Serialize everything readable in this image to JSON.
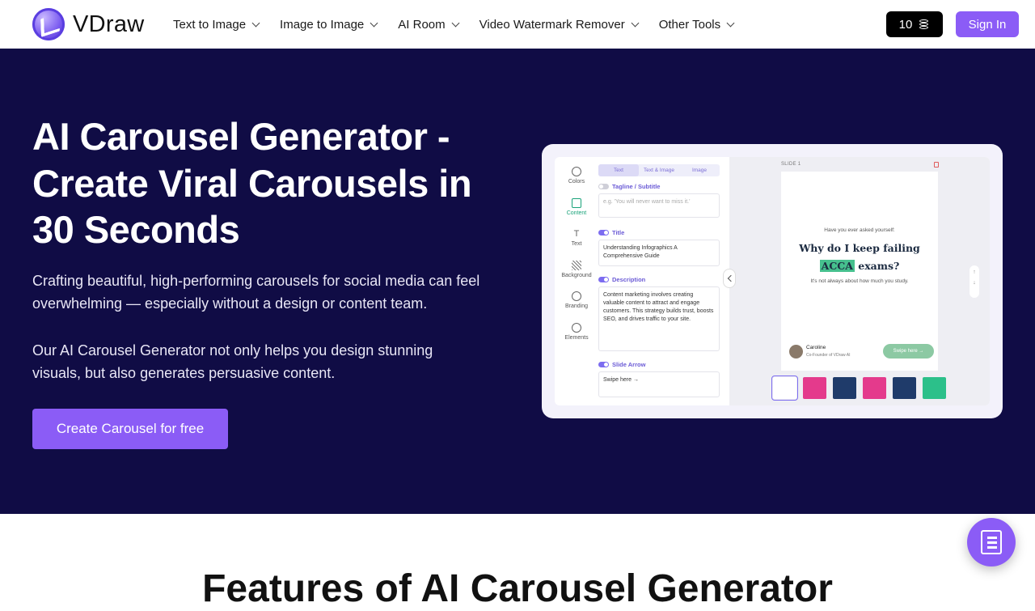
{
  "brand": {
    "name": "VDraw"
  },
  "nav": {
    "items": [
      {
        "label": "Text to Image"
      },
      {
        "label": "Image to Image"
      },
      {
        "label": "AI Room"
      },
      {
        "label": "Video Watermark Remover"
      },
      {
        "label": "Other Tools"
      }
    ],
    "credits": "10",
    "sign_in": "Sign In"
  },
  "hero": {
    "title": "AI Carousel Generator - Create Viral Carousels in 30 Seconds",
    "p1": "Crafting beautiful, high-performing carousels for social media can feel overwhelming — especially without a design or content team.",
    "p2": "Our AI Carousel Generator not only helps you design stunning visuals, but also generates persuasive content.",
    "cta": "Create Carousel for free"
  },
  "preview": {
    "sidebar": [
      {
        "label": "Colors"
      },
      {
        "label": "Content"
      },
      {
        "label": "Text"
      },
      {
        "label": "Background"
      },
      {
        "label": "Branding"
      },
      {
        "label": "Elements"
      }
    ],
    "tabs": [
      "Text",
      "Text & Image",
      "Image"
    ],
    "tagline_label": "Tagline / Subtitle",
    "tagline_placeholder": "e.g. 'You will never want to miss it.'",
    "title_label": "Title",
    "title_value": "Understanding Infographics A Comprehensive Guide",
    "description_label": "Description",
    "description_value": "Content marketing involves creating valuable content to attract and engage customers. This strategy builds trust, boosts SEO, and drives traffic to your site.",
    "arrow_label": "Slide Arrow",
    "arrow_value": "Swipe here →",
    "slide_label": "SLIDE 1",
    "slide": {
      "pre": "Have you ever asked yourself:",
      "title_a": "Why do I keep failing",
      "title_hl": "ACCA",
      "title_b": "exams?",
      "sub": "It's not always about how much you study.",
      "author_name": "Caroline",
      "author_role": "Co-Founder of VDraw AI",
      "swipe": "Swipe here →"
    }
  },
  "features": {
    "title": "Features of AI Carousel Generator"
  }
}
